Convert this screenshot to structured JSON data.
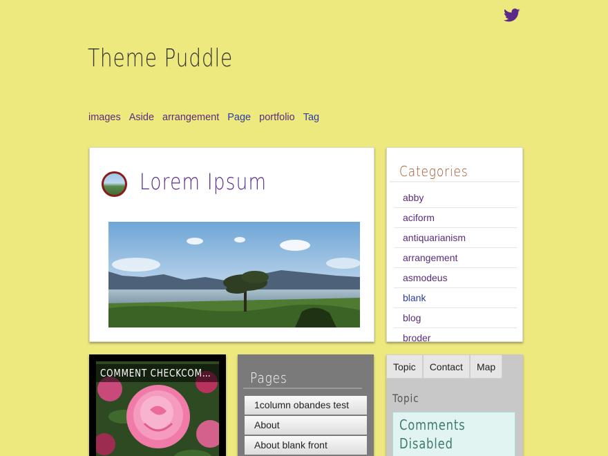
{
  "site": {
    "title": "Theme Puddle"
  },
  "social": {
    "icon": "twitter-icon",
    "color": "#5b2a86"
  },
  "nav": {
    "items": [
      {
        "label": "images"
      },
      {
        "label": "Aside"
      },
      {
        "label": "arrangement"
      },
      {
        "label": "Page"
      },
      {
        "label": "portfolio"
      },
      {
        "label": "Tag"
      }
    ]
  },
  "post": {
    "title": "Lorem Ipsum",
    "image": "lake-landscape"
  },
  "categories": {
    "title": "Categories",
    "items": [
      "abby",
      "aciform",
      "antiquarianism",
      "arrangement",
      "asmodeus",
      "blank",
      "blog",
      "broder"
    ]
  },
  "comment_widget": {
    "title": "COMMENT CHECKCOM…",
    "image": "pink-rose"
  },
  "pages": {
    "title": "Pages",
    "items": [
      "1column obandes test",
      "About",
      "About blank front"
    ]
  },
  "tabs": {
    "labels": [
      "Topic",
      "Contact",
      "Map"
    ],
    "heading": "Topic",
    "content": "Comments Disabled"
  },
  "colors": {
    "background": "#ede97e",
    "link_purple": "#5a2b7c",
    "link_blue": "#2f3aa8",
    "accent_title": "#5a2b8c",
    "categories_title": "#a0522d"
  }
}
